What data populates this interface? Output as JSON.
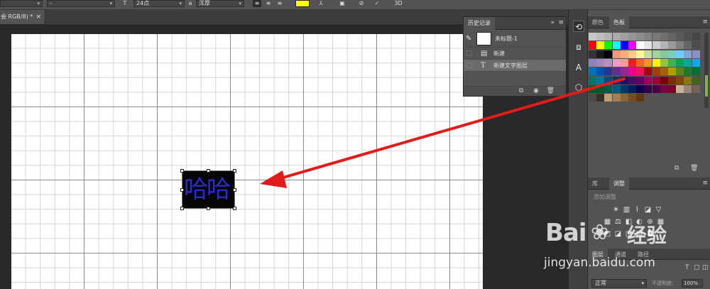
{
  "optionsbar": {
    "font_style": "-",
    "font_size_icon": "font-size-icon",
    "font_size": "24点",
    "antialias_icon": "antialias-icon",
    "antialias": "浑厚",
    "text_color": "#ffff00",
    "warp_icon": "warp-text-icon",
    "panels_icon": "toggle-panels-icon",
    "cancel_icon": "cancel-icon",
    "commit_icon": "commit-icon",
    "three_d_label": "3D"
  },
  "document_tab": {
    "title": "会 RGB/8) *",
    "close": "×"
  },
  "canvas": {
    "text_layer_content": "哈哈",
    "text_color": "#2b2bd0"
  },
  "history_panel": {
    "tab_label": "历史记录",
    "expand_glyph": "»",
    "menu_glyph": "≡",
    "snapshot_label": "未标题-1",
    "items": [
      {
        "label": "新建",
        "icon": "document-icon"
      },
      {
        "label": "新建文字图层",
        "icon": "type-tool-icon"
      }
    ]
  },
  "swatches_panel": {
    "tabs": [
      "颜色",
      "色板"
    ],
    "active_tab": "色板",
    "colors": [
      "#c8c8c8",
      "#bebebe",
      "#b4b4b4",
      "#aaaaaa",
      "#a0a0a0",
      "#969696",
      "#8c8c8c",
      "#828282",
      "#787878",
      "#6e6e6e",
      "#646464",
      "#5a5a5a",
      "#505050",
      "#464646",
      "#ff0000",
      "#ffff00",
      "#00ff00",
      "#00ffff",
      "#0000ff",
      "#ff00ff",
      "#ffffff",
      "#e6e6e6",
      "#cccccc",
      "#b3b3b3",
      "#999999",
      "#808080",
      "#666666",
      "#4d4d4d",
      "#333333",
      "#1a1a1a",
      "#000000",
      "#f7977a",
      "#f9ad81",
      "#fdc68a",
      "#fff79a",
      "#c4df9b",
      "#a3d39c",
      "#82ca9d",
      "#7bcdc8",
      "#6ecff6",
      "#7ea7d8",
      "#8493ca",
      "#8882be",
      "#a187be",
      "#bc8dbf",
      "#f49ac2",
      "#f6989d",
      "#ed1c24",
      "#f26522",
      "#f7941d",
      "#fff200",
      "#8dc63f",
      "#39b54a",
      "#00a651",
      "#00a99d",
      "#00aeef",
      "#0072bc",
      "#0054a6",
      "#2e3192",
      "#662d91",
      "#92278f",
      "#ec008c",
      "#ed145b",
      "#9e0b0f",
      "#a0410d",
      "#a36209",
      "#aba000",
      "#598527",
      "#1a7b30",
      "#007236",
      "#00746b",
      "#0076a3",
      "#004b80",
      "#003471",
      "#1b1464",
      "#440e62",
      "#630460",
      "#9e005d",
      "#9e0039",
      "#790000",
      "#7b2e00",
      "#7d4900",
      "#827b00",
      "#406618",
      "#005e20",
      "#005826",
      "#005952",
      "#005b7f",
      "#003663",
      "#002157",
      "#0d004c",
      "#32004b",
      "#4b0049",
      "#7b0046",
      "#7a0026",
      "#c7b299",
      "#998675",
      "#736357",
      "#534741",
      "#37302a",
      "#c69c6d",
      "#a67c52",
      "#8c6239",
      "#754c24",
      "#603913"
    ]
  },
  "adjustments_panel": {
    "tabs": [
      "库",
      "调整"
    ],
    "active_tab": "调整",
    "add_label": "添加调整",
    "icons_row1": [
      "brightness-icon",
      "levels-icon",
      "curves-icon",
      "exposure-icon",
      "vibrance-icon"
    ],
    "icons_row2": [
      "hue-saturation-icon",
      "color-balance-icon",
      "black-white-icon",
      "photo-filter-icon",
      "channel-mixer-icon",
      "color-lookup-icon"
    ],
    "icons_row3": [
      "invert-icon",
      "posterize-icon",
      "threshold-icon",
      "gradient-map-icon",
      "selective-color-icon"
    ]
  },
  "layers_panel": {
    "tabs": [
      "图层",
      "通道",
      "路径"
    ],
    "blend_mode": "正常",
    "opacity_label": "不透明度:",
    "opacity_value": "100%"
  },
  "watermark": {
    "brand": "Bai",
    "brand_suffix": "经验",
    "url": "jingyan.baidu.com"
  },
  "annotation": {
    "arrow_color": "#e31b1b"
  }
}
